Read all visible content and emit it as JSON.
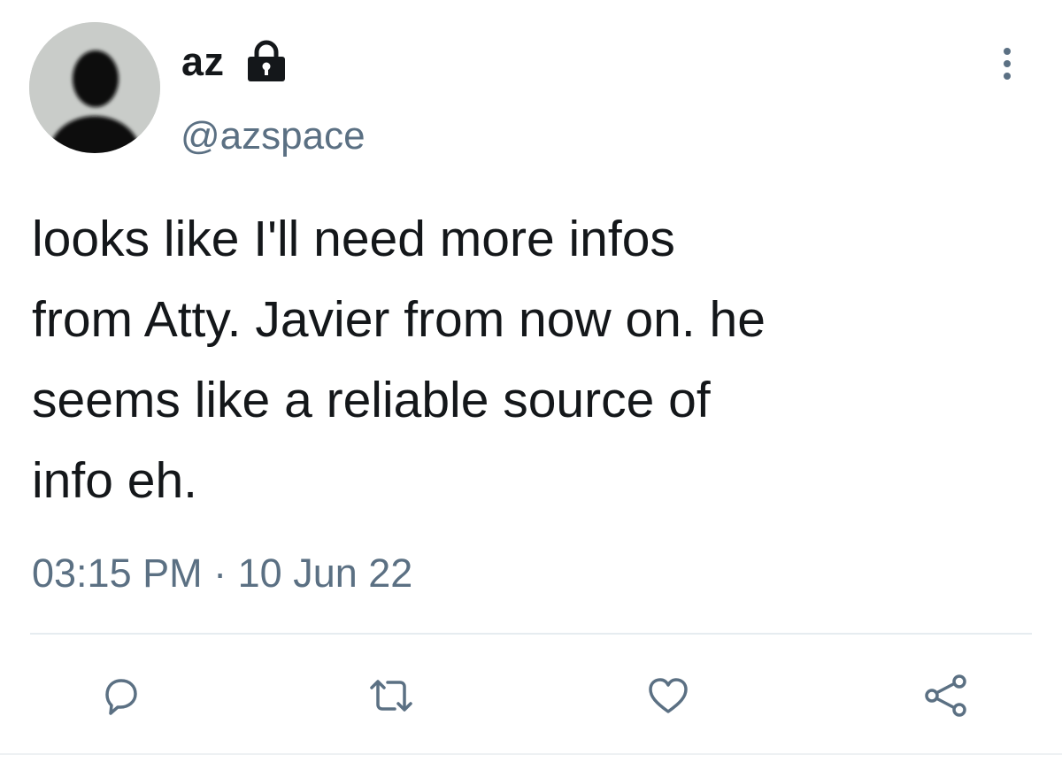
{
  "author": {
    "display_name": "az",
    "handle": "@azspace",
    "avatar_icon": "default-profile-silhouette",
    "protected_icon": "lock-icon"
  },
  "tweet": {
    "text": "looks like I'll need more infos\nfrom Atty. Javier from now on. he\nseems like a reliable source of\ninfo eh.",
    "time": "03:15 PM",
    "separator": "·",
    "date": "10 Jun 22"
  },
  "actions": [
    {
      "icon": "reply-icon"
    },
    {
      "icon": "retweet-icon"
    },
    {
      "icon": "like-icon"
    },
    {
      "icon": "share-icon"
    }
  ],
  "menu": {
    "icon": "more-options-icon"
  },
  "colors": {
    "text": "#14171a",
    "secondary": "#5b7083",
    "icon": "#5b7083",
    "divider": "#e6ecf0"
  }
}
